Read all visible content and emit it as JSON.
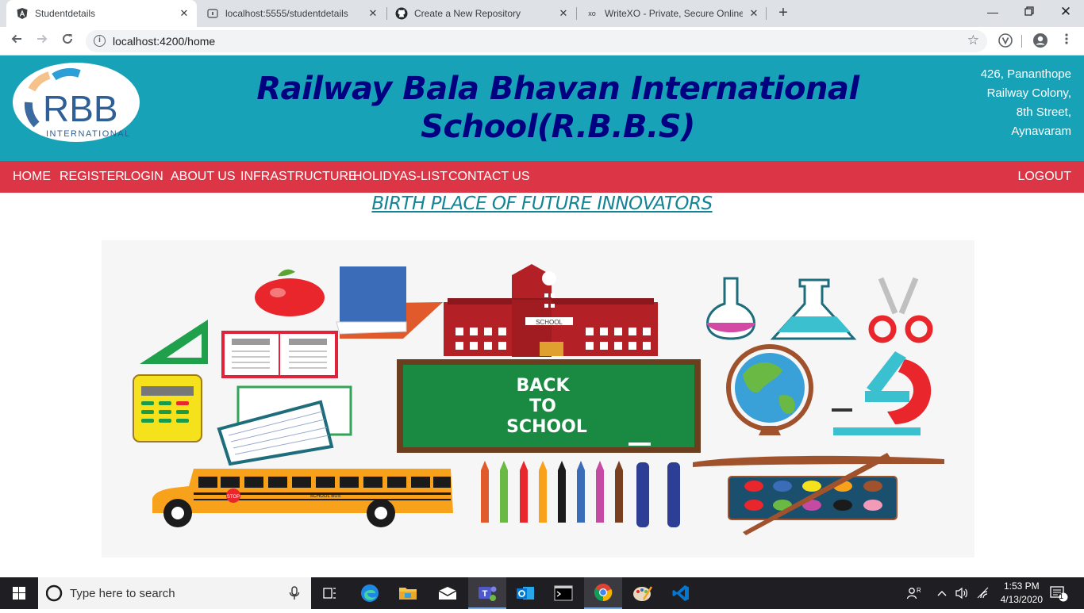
{
  "browser": {
    "tabs": [
      {
        "title": "Studentdetails",
        "icon": "angular-icon",
        "active": true
      },
      {
        "title": "localhost:5555/studentdetails",
        "icon": "page-icon",
        "active": false
      },
      {
        "title": "Create a New Repository",
        "icon": "github-icon",
        "active": false
      },
      {
        "title": "WriteXO - Private, Secure Online",
        "icon": "xo-icon",
        "active": false
      }
    ],
    "url": "localhost:4200/home",
    "xo_text": "xo"
  },
  "header": {
    "logo_text": "RBB",
    "logo_subtext": "INTERNATIONAL",
    "title_line1": "Railway Bala Bhavan International",
    "title_line2": "School(R.B.B.S)",
    "address": [
      "426, Pananthope",
      "Railway Colony,",
      "8th Street,",
      "Aynavaram"
    ]
  },
  "nav": {
    "items": [
      "HOME",
      "REGISTER",
      "LOGIN",
      "ABOUT US",
      "INFRASTRUCTURE",
      "HOLIDYAS-LIST",
      "CONTACT US"
    ],
    "logout": "LOGOUT"
  },
  "tagline": "BIRTH PLACE OF FUTURE INNOVATORS",
  "banner": {
    "board_text": [
      "BACK",
      "TO",
      "SCHOOL"
    ],
    "building_sign": "SCHOOL",
    "bus_label": "SCHOOL BUS",
    "stop_sign": "STOP"
  },
  "taskbar": {
    "search_placeholder": "Type here to search",
    "time": "1:53 PM",
    "date": "4/13/2020",
    "notification_count": "1"
  },
  "colors": {
    "header_bg": "#17a2b8",
    "nav_bg": "#dc3545",
    "title_color": "#000080",
    "tagline_color": "#138496"
  }
}
